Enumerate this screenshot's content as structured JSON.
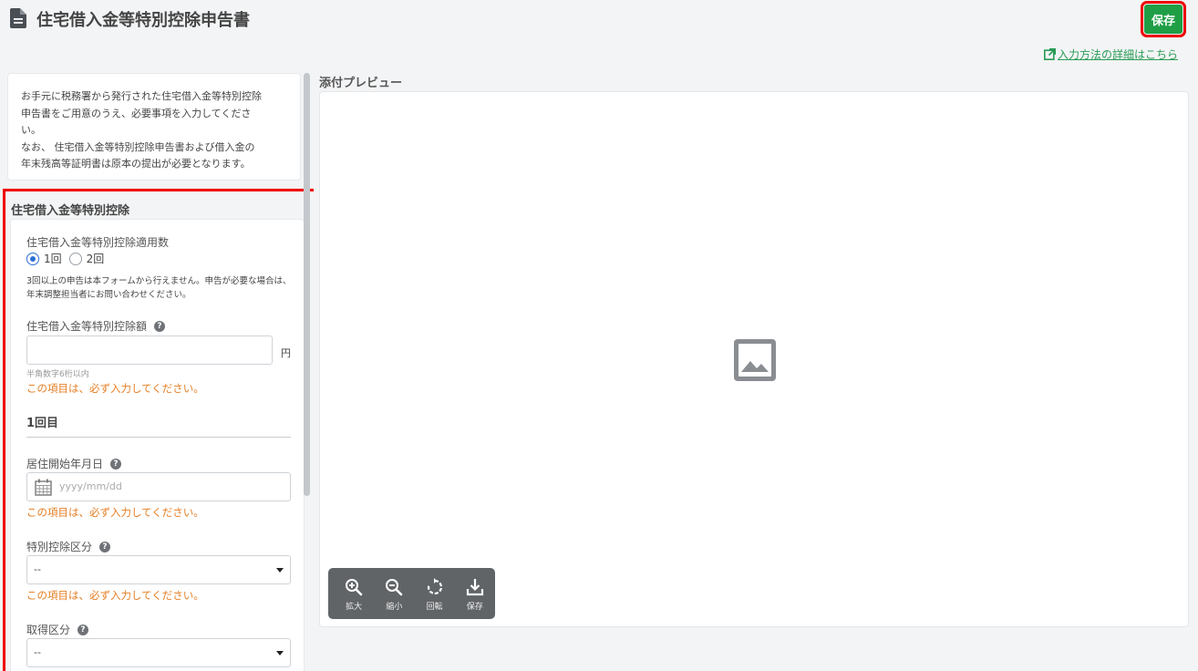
{
  "header": {
    "title": "住宅借入金等特別控除申告書",
    "save_label": "保存",
    "help_link": "入力方法の詳細はこちら"
  },
  "info": {
    "lines": [
      "お手元に税務署から発行された住宅借入金等特別控除",
      "申告書をご用意のうえ、必要事項を入力してくださ",
      "い。",
      "なお、 住宅借入金等特別控除申告書および借入金の",
      "年末残高等証明書は原本の提出が必要となります。"
    ]
  },
  "section": {
    "title": "住宅借入金等特別控除",
    "count_label": "住宅借入金等特別控除適用数",
    "radio_options": [
      "1回",
      "2回"
    ],
    "radio_selected": "1回",
    "count_note": "3回以上の申告は本フォームから行えません。申告が必要な場合は、年末調整担当者にお問い合わせください。",
    "amount_label": "住宅借入金等特別控除額",
    "amount_value": "",
    "amount_unit": "円",
    "amount_hint": "半角数字6桁以内",
    "required_error": "この項目は、必ず入力してください。",
    "sub_title": "1回目",
    "start_date_label": "居住開始年月日",
    "start_date_placeholder": "yyyy/mm/dd",
    "category_label": "特別控除区分",
    "category_value": "--",
    "acquisition_label": "取得区分",
    "acquisition_value": "--"
  },
  "preview": {
    "title": "添付プレビュー",
    "tools": [
      {
        "icon": "zoom-in-icon",
        "label": "拡大"
      },
      {
        "icon": "zoom-out-icon",
        "label": "縮小"
      },
      {
        "icon": "rotate-icon",
        "label": "回転"
      },
      {
        "icon": "download-icon",
        "label": "保存"
      }
    ]
  },
  "colors": {
    "accent_green": "#1f9e46",
    "highlight_red": "#e00000",
    "error_orange": "#e67e22",
    "radio_blue": "#2b6fd6"
  }
}
